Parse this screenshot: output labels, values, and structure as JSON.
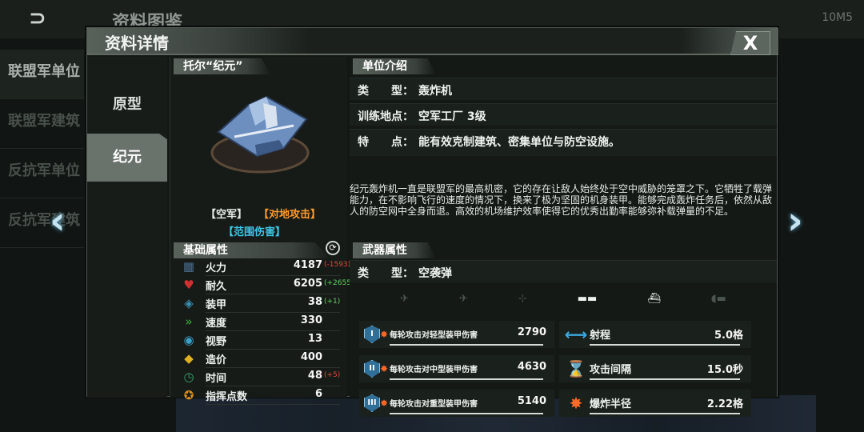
{
  "background": {
    "title": "资料图鉴",
    "status": "10M5",
    "side_items": [
      "联盟军单位",
      "联盟军建筑",
      "反抗军单位",
      "反抗军建筑"
    ]
  },
  "panel": {
    "title": "资料详情",
    "close_label": "X",
    "tabs": [
      "原型",
      "纪元"
    ]
  },
  "unit": {
    "name": "托尔“纪元”",
    "tag_air": "【空军】",
    "tag_attack": "【对地攻击】",
    "tag_area": "【范围伤害】",
    "colors": {
      "air": "#f0f0f0",
      "attack": "#ff9a2a",
      "area": "#3fc6e6"
    }
  },
  "base_stats": {
    "header": "基础属性",
    "rows": [
      {
        "icon": "firepower-icon",
        "name": "火力",
        "value": "4187",
        "bonus": "(-1593)",
        "bonus_color": "#e0483a"
      },
      {
        "icon": "heart-icon",
        "name": "耐久",
        "value": "6205",
        "bonus": "(+2655)",
        "bonus_color": "#5cd65c"
      },
      {
        "icon": "shield-icon",
        "name": "装甲",
        "value": "38",
        "bonus": "(+1)",
        "bonus_color": "#5cd65c"
      },
      {
        "icon": "speed-icon",
        "name": "速度",
        "value": "330",
        "bonus": "",
        "bonus_color": ""
      },
      {
        "icon": "eye-icon",
        "name": "视野",
        "value": "13",
        "bonus": "",
        "bonus_color": ""
      },
      {
        "icon": "cost-icon",
        "name": "造价",
        "value": "400",
        "bonus": "",
        "bonus_color": ""
      },
      {
        "icon": "time-icon",
        "name": "时间",
        "value": "48",
        "bonus": "(+5)",
        "bonus_color": "#e0483a"
      },
      {
        "icon": "command-icon",
        "name": "指挥点数",
        "value": "6",
        "bonus": "",
        "bonus_color": ""
      }
    ]
  },
  "intro": {
    "header": "单位介绍",
    "type_label": "类　　型：",
    "type_value": "轰炸机",
    "site_label": "训练地点：",
    "site_value": "空军工厂 3级",
    "feature_label": "特　　点：",
    "feature_value": "能有效克制建筑、密集单位与防空设施。",
    "description": "纪元轰炸机一直是联盟军的最高机密，它的存在让敌人始终处于空中威胁的笼罩之下。它牺牲了载弹能力，在不影响飞行的速度的情况下，换来了极为坚固的机身装甲。能够完成轰炸任务后，依然从敌人的防空网中全身而退。高效的机场维护效率使得它的优秀出勤率能够弥补载弹量的不足。"
  },
  "weapon": {
    "header": "武器属性",
    "type_label": "类　　型：",
    "type_value": "空袭弹",
    "target_icons": [
      "jet-icon",
      "plane-icon",
      "helicopter-icon",
      "tank-icon",
      "ship-icon",
      "submarine-icon"
    ],
    "target_active": [
      false,
      false,
      false,
      true,
      true,
      false
    ],
    "damage": [
      {
        "icon": "armor-light-icon",
        "badge": "I",
        "name": "每轮攻击对轻型装甲伤害",
        "value": "2790"
      },
      {
        "icon": "armor-medium-icon",
        "badge": "II",
        "name": "每轮攻击对中型装甲伤害",
        "value": "4630"
      },
      {
        "icon": "armor-heavy-icon",
        "badge": "III",
        "name": "每轮攻击对重型装甲伤害",
        "value": "5140"
      }
    ],
    "specs": [
      {
        "icon": "range-icon",
        "glyph": "⟷",
        "name": "射程",
        "value": "5.0格"
      },
      {
        "icon": "hourglass-icon",
        "glyph": "⌛",
        "name": "攻击间隔",
        "value": "15.0秒"
      },
      {
        "icon": "explosion-icon",
        "glyph": "✸",
        "name": "爆炸半径",
        "value": "2.22格"
      }
    ]
  }
}
